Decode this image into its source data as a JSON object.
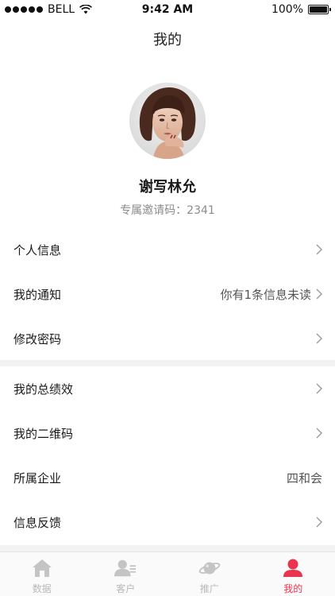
{
  "status_bar": {
    "carrier": "BELL",
    "time": "9:42 AM",
    "battery_percent": "100%",
    "battery_level": 1.0
  },
  "nav": {
    "title": "我的"
  },
  "profile": {
    "name": "谢写林允",
    "invite_label": "专属邀请码：2341"
  },
  "menu_group_1": [
    {
      "label": "个人信息",
      "value": "",
      "chevron": true
    },
    {
      "label": "我的通知",
      "value": "你有1条信息未读",
      "chevron": true
    },
    {
      "label": "修改密码",
      "value": "",
      "chevron": true
    }
  ],
  "menu_group_2": [
    {
      "label": "我的总绩效",
      "value": "",
      "chevron": true
    },
    {
      "label": "我的二维码",
      "value": "",
      "chevron": true
    },
    {
      "label": "所属企业",
      "value": "四和会",
      "chevron": false
    },
    {
      "label": "信息反馈",
      "value": "",
      "chevron": true
    }
  ],
  "tab_bar": {
    "active_color": "#e8344e",
    "inactive_color": "#b8b8b8",
    "tabs": [
      {
        "label": "数据",
        "icon": "home-icon",
        "active": false
      },
      {
        "label": "客户",
        "icon": "customer-icon",
        "active": false
      },
      {
        "label": "推广",
        "icon": "planet-icon",
        "active": false
      },
      {
        "label": "我的",
        "icon": "profile-icon",
        "active": true
      }
    ]
  }
}
